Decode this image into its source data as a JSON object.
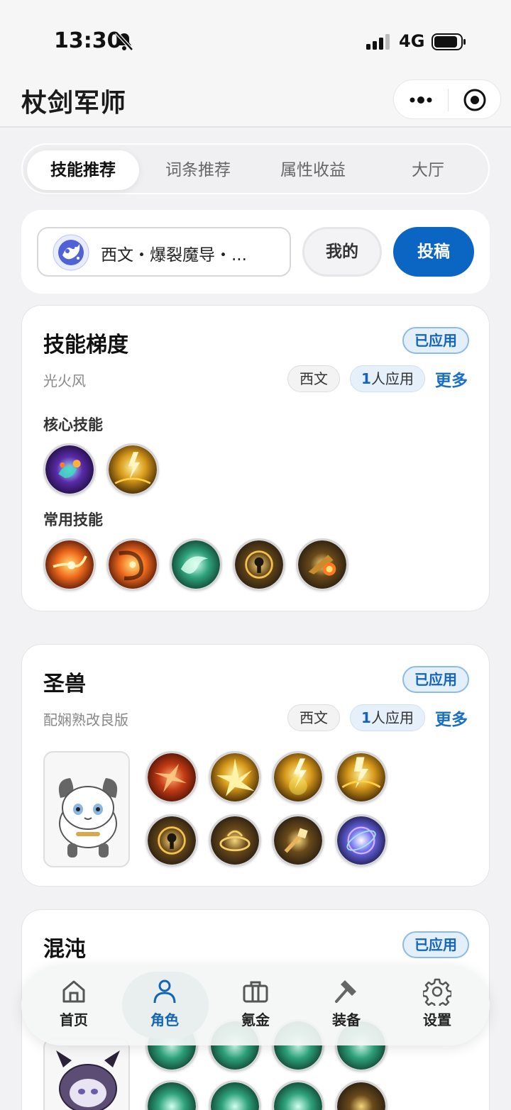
{
  "status_bar": {
    "time": "13:30",
    "network": "4G"
  },
  "app": {
    "title": "杖剑军师"
  },
  "tabs": [
    {
      "label": "技能推荐",
      "active": true
    },
    {
      "label": "词条推荐",
      "active": false
    },
    {
      "label": "属性收益",
      "active": false
    },
    {
      "label": "大厅",
      "active": false
    }
  ],
  "selector": {
    "current": "西文・爆裂魔导・...",
    "mine_label": "我的",
    "post_label": "投稿"
  },
  "cards": [
    {
      "title": "技能梯度",
      "applied_label": "已应用",
      "subtitle": "光火风",
      "tag": "西文",
      "user_count": "1",
      "user_suffix": "人应用",
      "more_label": "更多",
      "core_label": "核心技能",
      "common_label": "常用技能"
    },
    {
      "title": "圣兽",
      "applied_label": "已应用",
      "subtitle": "配娴熟改良版",
      "tag": "西文",
      "user_count": "1",
      "user_suffix": "人应用",
      "more_label": "更多"
    },
    {
      "title": "混沌",
      "applied_label": "已应用"
    }
  ],
  "bottom_nav": [
    {
      "label": "首页",
      "icon": "home-icon"
    },
    {
      "label": "角色",
      "icon": "user-icon",
      "active": true
    },
    {
      "label": "氪金",
      "icon": "briefcase-icon"
    },
    {
      "label": "装备",
      "icon": "hammer-icon"
    },
    {
      "label": "设置",
      "icon": "gear-icon"
    }
  ],
  "colors": {
    "accent": "#0b66c3",
    "badge_bg": "#e3f0fb",
    "link": "#1a6fc9"
  }
}
